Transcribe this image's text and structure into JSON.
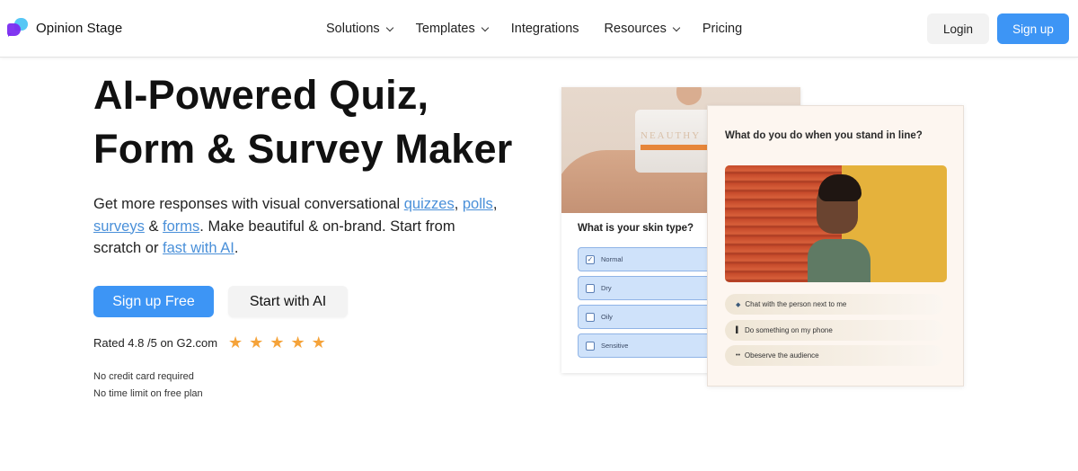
{
  "brand": {
    "name": "Opinion Stage",
    "logo_icon": "chat-bubbles-icon"
  },
  "nav": {
    "items": [
      {
        "label": "Solutions",
        "has_dropdown": true
      },
      {
        "label": "Templates",
        "has_dropdown": true
      },
      {
        "label": "Integrations",
        "has_dropdown": false
      },
      {
        "label": "Resources",
        "has_dropdown": true
      },
      {
        "label": "Pricing",
        "has_dropdown": false
      }
    ],
    "login_label": "Login",
    "signup_label": "Sign up"
  },
  "hero": {
    "title_line1": "AI-Powered Quiz,",
    "title_line2": "Form & Survey Maker",
    "sub_text_1": "Get more responses with visual conversational ",
    "link_quizzes": "quizzes",
    "sep_1": ", ",
    "link_polls": "polls",
    "sep_2": ", ",
    "link_surveys": "surveys",
    "sep_3": " & ",
    "link_forms": "forms",
    "sub_text_2": ". Make beautiful & on-brand. Start from scratch or ",
    "link_ai": "fast with AI",
    "sub_text_3": ".",
    "primary_cta": "Sign up Free",
    "secondary_cta": "Start with AI",
    "rating_text": "Rated 4.8 /5 on G2.com",
    "rating_value": 4.8,
    "rating_max": 5,
    "notes": [
      "No credit card required",
      "No time limit on free plan"
    ]
  },
  "preview_skin": {
    "brand_on_jar": "NEAUTHY",
    "question": "What is your skin type?",
    "options": [
      {
        "label": "Normal",
        "checked": true
      },
      {
        "label": "Dry",
        "checked": false
      },
      {
        "label": "Oily",
        "checked": false
      },
      {
        "label": "Sensitive",
        "checked": false
      }
    ]
  },
  "preview_line": {
    "question": "What do you do when you stand in line?",
    "options": [
      {
        "icon": "speech-bubble-icon",
        "glyph": "◆",
        "label": "Chat with the person next to me"
      },
      {
        "icon": "phone-icon",
        "glyph": "▌",
        "label": "Do something on my phone"
      },
      {
        "icon": "eyes-icon",
        "glyph": "••",
        "label": "Obeserve the audience"
      }
    ]
  },
  "colors": {
    "accent": "#3d95f5",
    "link": "#4a90d9",
    "star": "#f5a33a"
  }
}
